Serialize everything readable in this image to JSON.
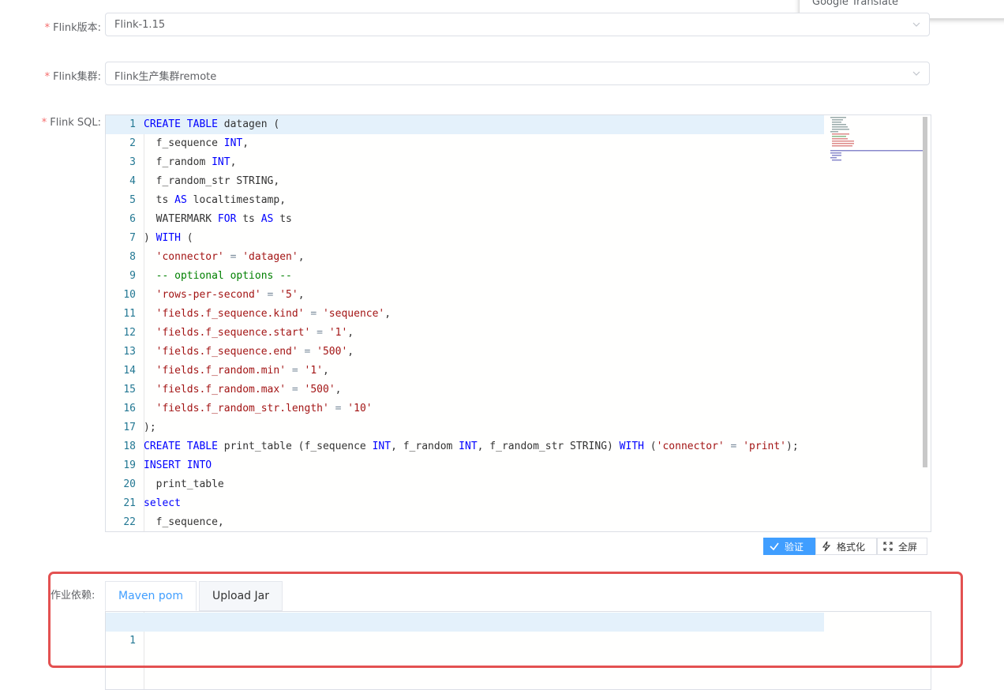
{
  "form": {
    "flink_version": {
      "label": "Flink版本:",
      "value": "Flink-1.15"
    },
    "flink_cluster": {
      "label": "Flink集群:",
      "value": "Flink生产集群remote"
    },
    "flink_sql": {
      "label": "Flink SQL:"
    }
  },
  "sql_lines": [
    {
      "n": "1",
      "tokens": [
        [
          "kw",
          "CREATE TABLE"
        ],
        [
          "",
          " datagen ("
        ]
      ]
    },
    {
      "n": "2",
      "tokens": [
        [
          "",
          "  f_sequence "
        ],
        [
          "kw",
          "INT"
        ],
        [
          "",
          ","
        ]
      ]
    },
    {
      "n": "3",
      "tokens": [
        [
          "",
          "  f_random "
        ],
        [
          "kw",
          "INT"
        ],
        [
          "",
          ","
        ]
      ]
    },
    {
      "n": "4",
      "tokens": [
        [
          "",
          "  f_random_str STRING,"
        ]
      ]
    },
    {
      "n": "5",
      "tokens": [
        [
          "",
          "  ts "
        ],
        [
          "kw",
          "AS"
        ],
        [
          "",
          " localtimestamp,"
        ]
      ]
    },
    {
      "n": "6",
      "tokens": [
        [
          "",
          "  WATERMARK "
        ],
        [
          "kw",
          "FOR"
        ],
        [
          "",
          " ts "
        ],
        [
          "kw",
          "AS"
        ],
        [
          "",
          " ts"
        ]
      ]
    },
    {
      "n": "7",
      "tokens": [
        [
          "",
          ") "
        ],
        [
          "kw",
          "WITH"
        ],
        [
          "",
          " ("
        ]
      ]
    },
    {
      "n": "8",
      "tokens": [
        [
          "",
          "  "
        ],
        [
          "str",
          "'connector'"
        ],
        [
          "op",
          " = "
        ],
        [
          "str",
          "'datagen'"
        ],
        [
          "",
          ","
        ]
      ]
    },
    {
      "n": "9",
      "tokens": [
        [
          "",
          "  "
        ],
        [
          "cm",
          "-- optional options --"
        ]
      ]
    },
    {
      "n": "10",
      "tokens": [
        [
          "",
          "  "
        ],
        [
          "str",
          "'rows-per-second'"
        ],
        [
          "op",
          " = "
        ],
        [
          "str",
          "'5'"
        ],
        [
          "",
          ","
        ]
      ]
    },
    {
      "n": "11",
      "tokens": [
        [
          "",
          "  "
        ],
        [
          "str",
          "'fields.f_sequence.kind'"
        ],
        [
          "op",
          " = "
        ],
        [
          "str",
          "'sequence'"
        ],
        [
          "",
          ","
        ]
      ]
    },
    {
      "n": "12",
      "tokens": [
        [
          "",
          "  "
        ],
        [
          "str",
          "'fields.f_sequence.start'"
        ],
        [
          "op",
          " = "
        ],
        [
          "str",
          "'1'"
        ],
        [
          "",
          ","
        ]
      ]
    },
    {
      "n": "13",
      "tokens": [
        [
          "",
          "  "
        ],
        [
          "str",
          "'fields.f_sequence.end'"
        ],
        [
          "op",
          " = "
        ],
        [
          "str",
          "'500'"
        ],
        [
          "",
          ","
        ]
      ]
    },
    {
      "n": "14",
      "tokens": [
        [
          "",
          "  "
        ],
        [
          "str",
          "'fields.f_random.min'"
        ],
        [
          "op",
          " = "
        ],
        [
          "str",
          "'1'"
        ],
        [
          "",
          ","
        ]
      ]
    },
    {
      "n": "15",
      "tokens": [
        [
          "",
          "  "
        ],
        [
          "str",
          "'fields.f_random.max'"
        ],
        [
          "op",
          " = "
        ],
        [
          "str",
          "'500'"
        ],
        [
          "",
          ","
        ]
      ]
    },
    {
      "n": "16",
      "tokens": [
        [
          "",
          "  "
        ],
        [
          "str",
          "'fields.f_random_str.length'"
        ],
        [
          "op",
          " = "
        ],
        [
          "str",
          "'10'"
        ]
      ]
    },
    {
      "n": "17",
      "tokens": [
        [
          "",
          ");"
        ]
      ]
    },
    {
      "n": "18",
      "tokens": [
        [
          "kw",
          "CREATE TABLE"
        ],
        [
          "",
          " print_table (f_sequence "
        ],
        [
          "kw",
          "INT"
        ],
        [
          "",
          ", f_random "
        ],
        [
          "kw",
          "INT"
        ],
        [
          "",
          ", f_random_str STRING) "
        ],
        [
          "kw",
          "WITH"
        ],
        [
          "",
          " ("
        ],
        [
          "str",
          "'connector'"
        ],
        [
          "op",
          " = "
        ],
        [
          "str",
          "'print'"
        ],
        [
          "",
          ");"
        ]
      ]
    },
    {
      "n": "19",
      "tokens": [
        [
          "kw",
          "INSERT INTO"
        ]
      ]
    },
    {
      "n": "20",
      "tokens": [
        [
          "",
          "  print_table"
        ]
      ]
    },
    {
      "n": "21",
      "tokens": [
        [
          "kw",
          "select"
        ]
      ]
    },
    {
      "n": "22",
      "tokens": [
        [
          "",
          "  f_sequence,"
        ]
      ]
    }
  ],
  "toolbar": {
    "verify": "验证",
    "format": "格式化",
    "fullscreen": "全屏"
  },
  "dependency": {
    "label": "作业依赖:",
    "tabs": [
      {
        "label": "Maven pom"
      },
      {
        "label": "Upload Jar"
      }
    ],
    "line1": "1"
  },
  "popup": {
    "text": "Google Translate"
  },
  "colors": {
    "primary": "#409eff",
    "highlight": "#e35151",
    "keyword": "#0000ff",
    "string": "#a31515",
    "comment": "#008000"
  }
}
